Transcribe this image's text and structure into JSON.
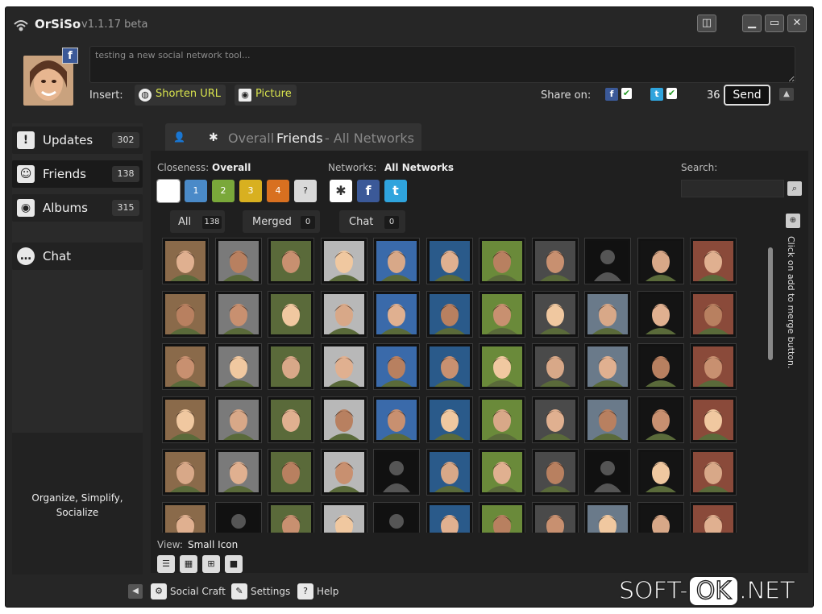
{
  "app": {
    "name": "OrSiSo",
    "version": "v1.1.17 beta"
  },
  "composer": {
    "status_text": "testing a new social network tool...",
    "insert_label": "Insert:",
    "shorten_url_label": "Shorten URL",
    "picture_label": "Picture",
    "share_label": "Share on:",
    "share_networks": [
      "f",
      "t"
    ],
    "char_count": "36",
    "send_label": "Send"
  },
  "sidebar": {
    "items": [
      {
        "label": "Updates",
        "count": "302",
        "icon": "exclamation-icon"
      },
      {
        "label": "Friends",
        "count": "138",
        "icon": "person-icon"
      },
      {
        "label": "Albums",
        "count": "315",
        "icon": "camera-icon"
      },
      {
        "label": "Chat",
        "icon": "speech-bubble-icon"
      }
    ],
    "tagline_line1": "Organize, Simplify,",
    "tagline_line2": "Socialize"
  },
  "main_tab": {
    "overall": "Overall",
    "friends": "Friends",
    "networks": "- All Networks"
  },
  "filters": {
    "closeness_label": "Closeness:",
    "closeness_value": "Overall",
    "closeness_buttons": [
      "",
      "1",
      "2",
      "3",
      "4",
      "?"
    ],
    "networks_label": "Networks:",
    "networks_value": "All Networks",
    "network_buttons": [
      "✱",
      "f",
      "t"
    ],
    "search_label": "Search:"
  },
  "subtabs": [
    {
      "label": "All",
      "count": "138"
    },
    {
      "label": "Merged",
      "count": "0"
    },
    {
      "label": "Chat",
      "count": "0"
    }
  ],
  "merge_hint": "Click on add to merge button.",
  "view": {
    "label": "View:",
    "value": "Small Icon"
  },
  "bottom_bar": {
    "social_craft": "Social Craft",
    "settings": "Settings",
    "help": "Help"
  },
  "watermark": {
    "left": "SOFT-",
    "ok": "OK",
    "right": ".NET"
  },
  "colors": {
    "facebook": "#3b5998",
    "twitter": "#2fa4dd",
    "accent_yellow": "#d8e34d",
    "background": "#262626"
  }
}
